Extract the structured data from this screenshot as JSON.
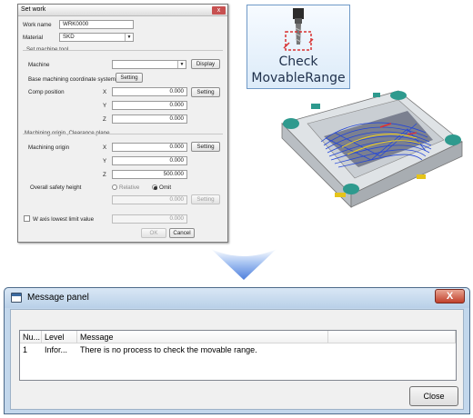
{
  "set_work": {
    "title": "Set work",
    "work_name_label": "Work name",
    "work_name_value": "WRK0000",
    "material_label": "Material",
    "material_value": "SKD",
    "set_machine_tool_label": "Set machine tool",
    "machine_label": "Machine",
    "machine_value": "",
    "display_button": "Display",
    "base_coord_label": "Base machining coordinate system",
    "base_coord_button": "Setting",
    "comp_position_label": "Comp position",
    "comp_position": {
      "x": "0.000",
      "y": "0.000",
      "z": "0.000"
    },
    "comp_setting_button": "Setting",
    "machining_origin_group_label": "Machining origin ,Clearance plane",
    "machining_origin_label": "Machining origin",
    "machining_origin": {
      "x": "0.000",
      "y": "0.000",
      "z": "500.000"
    },
    "origin_setting_button": "Setting",
    "axis_x": "X",
    "axis_y": "Y",
    "axis_z": "Z",
    "overall_safety_label": "Overall safety height",
    "relative_label": "Relative",
    "omit_label": "Omit",
    "safety_value": "0.000",
    "safety_setting_button": "Setting",
    "w_axis_label": "W axis lowest limit value",
    "w_axis_value": "0.000",
    "ok_button": "OK",
    "cancel_button": "Cancel",
    "close_glyph": "x"
  },
  "ribbon_button": {
    "line1": "Check",
    "line2": "MovableRange",
    "icon": "milling-tool-icon"
  },
  "model_image": {
    "icon": "mold-toolpath-3d-image"
  },
  "arrow": {
    "icon": "down-arrow-icon",
    "color": "#5b8de0"
  },
  "message_panel": {
    "title": "Message panel",
    "close_glyph": "X",
    "columns": [
      "Nu...",
      "Level",
      "Message"
    ],
    "rows": [
      {
        "number": "1",
        "level": "Infor...",
        "message": "There is no process to check the movable range."
      }
    ],
    "close_button": "Close"
  }
}
